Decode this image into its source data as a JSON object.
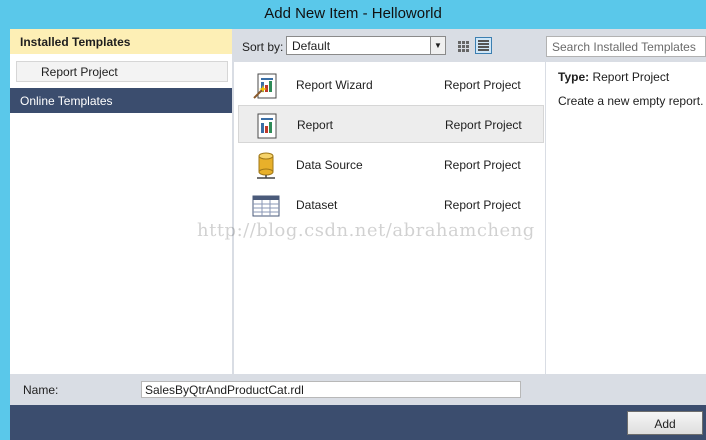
{
  "window": {
    "title": "Add New Item - Helloworld"
  },
  "left": {
    "installed_label": "Installed Templates",
    "installed_child": "Report Project",
    "online_label": "Online Templates"
  },
  "toolbar": {
    "sort_label": "Sort by:",
    "sort_value": "Default",
    "search_placeholder": "Search Installed Templates"
  },
  "items": [
    {
      "name": "Report Wizard",
      "type": "Report Project",
      "icon": "report-wizard-icon"
    },
    {
      "name": "Report",
      "type": "Report Project",
      "icon": "report-icon",
      "selected": true
    },
    {
      "name": "Data Source",
      "type": "Report Project",
      "icon": "data-source-icon"
    },
    {
      "name": "Dataset",
      "type": "Report Project",
      "icon": "dataset-icon"
    }
  ],
  "info": {
    "type_label": "Type:",
    "type_value": "Report Project",
    "description": "Create a new empty report."
  },
  "watermark": "http://blog.csdn.net/abrahamcheng",
  "name_field": {
    "label": "Name:",
    "value": "SalesByQtrAndProductCat.rdl"
  },
  "footer": {
    "add_label": "Add"
  },
  "colors": {
    "title_bar": "#5ac8ea",
    "installed_highlight": "#fdefb5",
    "nav_dark": "#3b4d6e",
    "panel_gray": "#d9dde4"
  }
}
